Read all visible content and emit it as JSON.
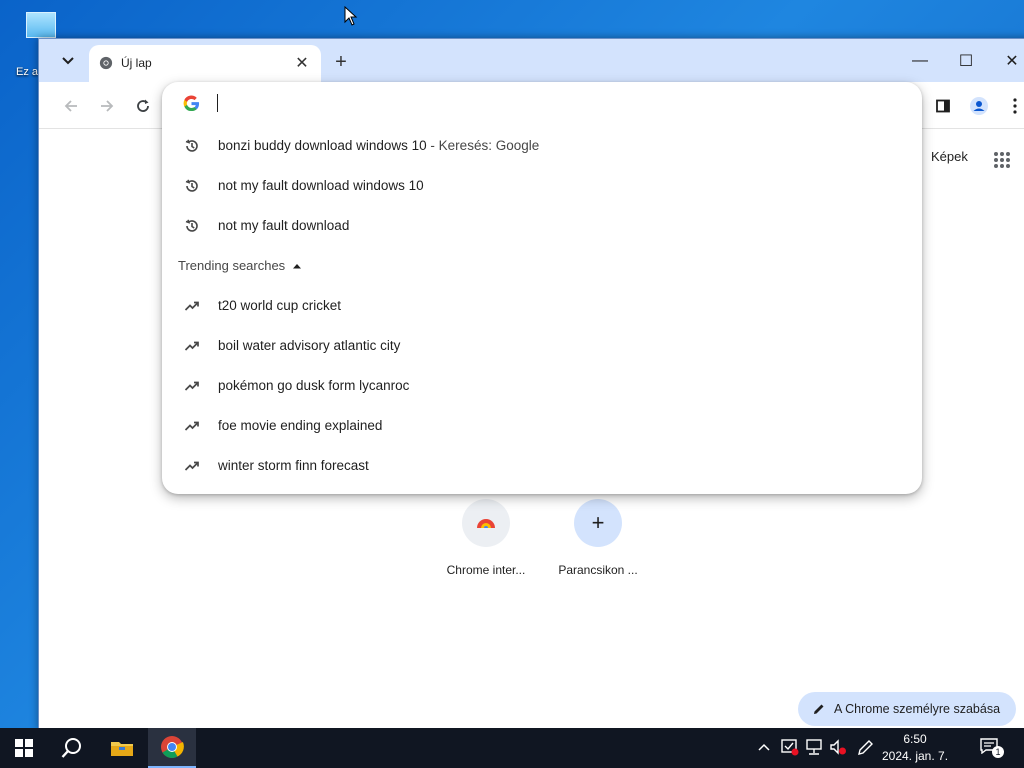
{
  "desktop": {
    "icon_label": "Ez a"
  },
  "browser": {
    "tab": {
      "title": "Új lap"
    },
    "window_controls": {
      "minimize": "—",
      "maximize": "☐",
      "close": "✕"
    },
    "ntp": {
      "images_link": "Képek",
      "shortcuts": [
        {
          "label": "Chrome inter..."
        },
        {
          "label": "Parancsikon ..."
        }
      ],
      "customize_label": "A Chrome személyre szabása"
    }
  },
  "omnibox": {
    "input_value": "",
    "history": [
      {
        "text": "bonzi buddy download windows 10",
        "suffix": "Keresés: Google",
        "icon": "history-icon"
      },
      {
        "text": "not my fault download windows 10",
        "icon": "history-icon"
      },
      {
        "text": "not my fault download",
        "icon": "history-icon"
      }
    ],
    "trending_header": "Trending searches",
    "trending": [
      {
        "text": "t20 world cup cricket",
        "icon": "trending-icon"
      },
      {
        "text": "boil water advisory atlantic city",
        "icon": "trending-icon"
      },
      {
        "text": "pokémon go dusk form lycanroc",
        "icon": "trending-icon"
      },
      {
        "text": "foe movie ending explained",
        "icon": "trending-icon"
      },
      {
        "text": "winter storm finn forecast",
        "icon": "trending-icon"
      }
    ]
  },
  "taskbar": {
    "time": "6:50",
    "date": "2024. jan. 7.",
    "notification_count": "1"
  },
  "colors": {
    "accent": "#d3e3fd",
    "taskbar": "#101622",
    "desktop": "#1f86e0"
  }
}
